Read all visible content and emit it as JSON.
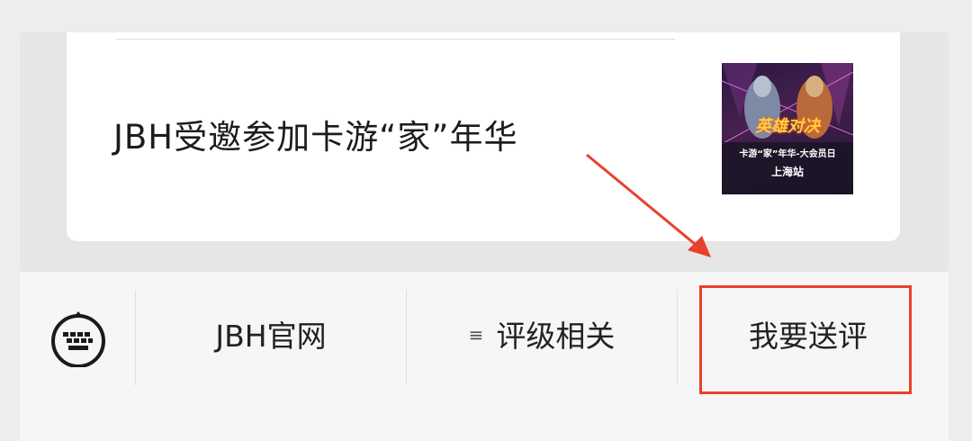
{
  "article_card": {
    "title": "JBH受邀参加卡游“家”年华",
    "thumbnail": {
      "logo_text": "英雄对决",
      "banner_text": "卡游“家”年华-大会员日",
      "station_text": "上海站"
    }
  },
  "bottom_menu": {
    "keyboard_icon": "keyboard-icon",
    "items": [
      {
        "label": "JBH官网"
      },
      {
        "label": "评级相关",
        "icon": "≡"
      },
      {
        "label": "我要送评"
      }
    ]
  },
  "annotation": {
    "arrow_color": "#e8412b",
    "box_color": "#e8412b"
  }
}
